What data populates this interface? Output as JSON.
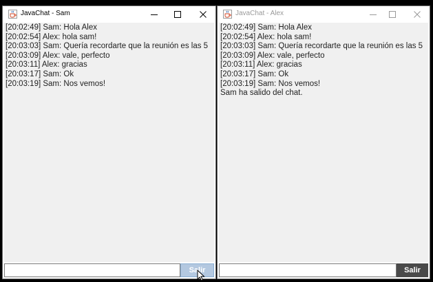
{
  "windows": {
    "sam": {
      "title": "JavaChat - Sam",
      "messages": [
        "[20:02:49] Sam: Hola Alex",
        "[20:02:54] Alex: hola sam!",
        "[20:03:03] Sam: Quería recordarte que la reunión es las 5",
        "[20:03:09] Alex: vale, perfecto",
        "[20:03:11] Alex: gracias",
        "[20:03:17] Sam: Ok",
        "[20:03:19] Sam: Nos vemos!"
      ],
      "input_value": "",
      "exit_label": "Salir"
    },
    "alex": {
      "title": "JavaChat - Alex",
      "messages": [
        "[20:02:49] Sam: Hola Alex",
        "[20:02:54] Alex: hola sam!",
        "[20:03:03] Sam: Quería recordarte que la reunión es las 5",
        "[20:03:09] Alex: vale, perfecto",
        "[20:03:11] Alex: gracias",
        "[20:03:17] Sam: Ok",
        "[20:03:19] Sam: Nos vemos!",
        "Sam ha salido del chat."
      ],
      "input_value": "",
      "exit_label": "Salir"
    }
  },
  "icons": {
    "app": "java-coffee-cup-icon",
    "minimize": "minimize-icon",
    "maximize": "maximize-icon",
    "close": "close-icon",
    "cursor": "mouse-pointer-icon"
  },
  "colors": {
    "desktop": "#000000",
    "chat_background": "#f0f0f0",
    "exit_button_pressed": "#b3c8e0",
    "exit_button": "#4a4a4a"
  }
}
